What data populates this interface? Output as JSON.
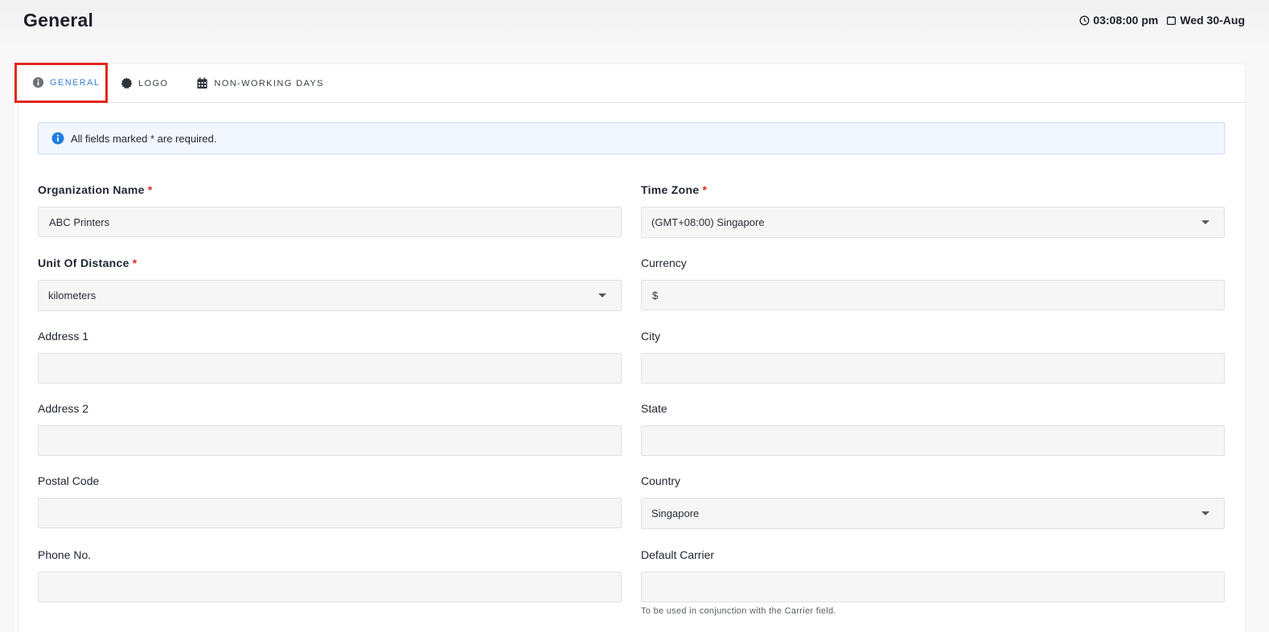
{
  "header": {
    "title": "General",
    "time": "03:08:00 pm",
    "date": "Wed 30-Aug",
    "time_icon": "clock-icon",
    "date_icon": "calendar-icon"
  },
  "tabs": [
    {
      "label": "GENERAL",
      "icon": "info-circle-icon",
      "active": true
    },
    {
      "label": "LOGO",
      "icon": "badge-icon",
      "active": false
    },
    {
      "label": "NON-WORKING DAYS",
      "icon": "calendar-grid-icon",
      "active": false
    }
  ],
  "alert": {
    "text": "All fields marked * are required.",
    "icon": "info-icon"
  },
  "form": {
    "organization_name": {
      "label": "Organization Name",
      "value": "ABC Printers",
      "required": true
    },
    "time_zone": {
      "label": "Time Zone",
      "value": "(GMT+08:00) Singapore",
      "required": true
    },
    "unit_of_distance": {
      "label": "Unit Of Distance",
      "value": "kilometers",
      "required": true
    },
    "currency": {
      "label": "Currency",
      "value": "$"
    },
    "address1": {
      "label": "Address 1",
      "value": ""
    },
    "city": {
      "label": "City",
      "value": ""
    },
    "address2": {
      "label": "Address 2",
      "value": ""
    },
    "state": {
      "label": "State",
      "value": ""
    },
    "postal_code": {
      "label": "Postal Code",
      "value": ""
    },
    "country": {
      "label": "Country",
      "value": "Singapore"
    },
    "phone": {
      "label": "Phone No.",
      "value": ""
    },
    "default_carrier": {
      "label": "Default Carrier",
      "value": "",
      "help": "To be used in conjunction with the Carrier field."
    },
    "required_mark": "*"
  },
  "colors": {
    "accent": "#3d7fd8",
    "required": "#e0291f",
    "highlight_border": "#e3271d",
    "alert_bg": "#f2f7ff"
  }
}
